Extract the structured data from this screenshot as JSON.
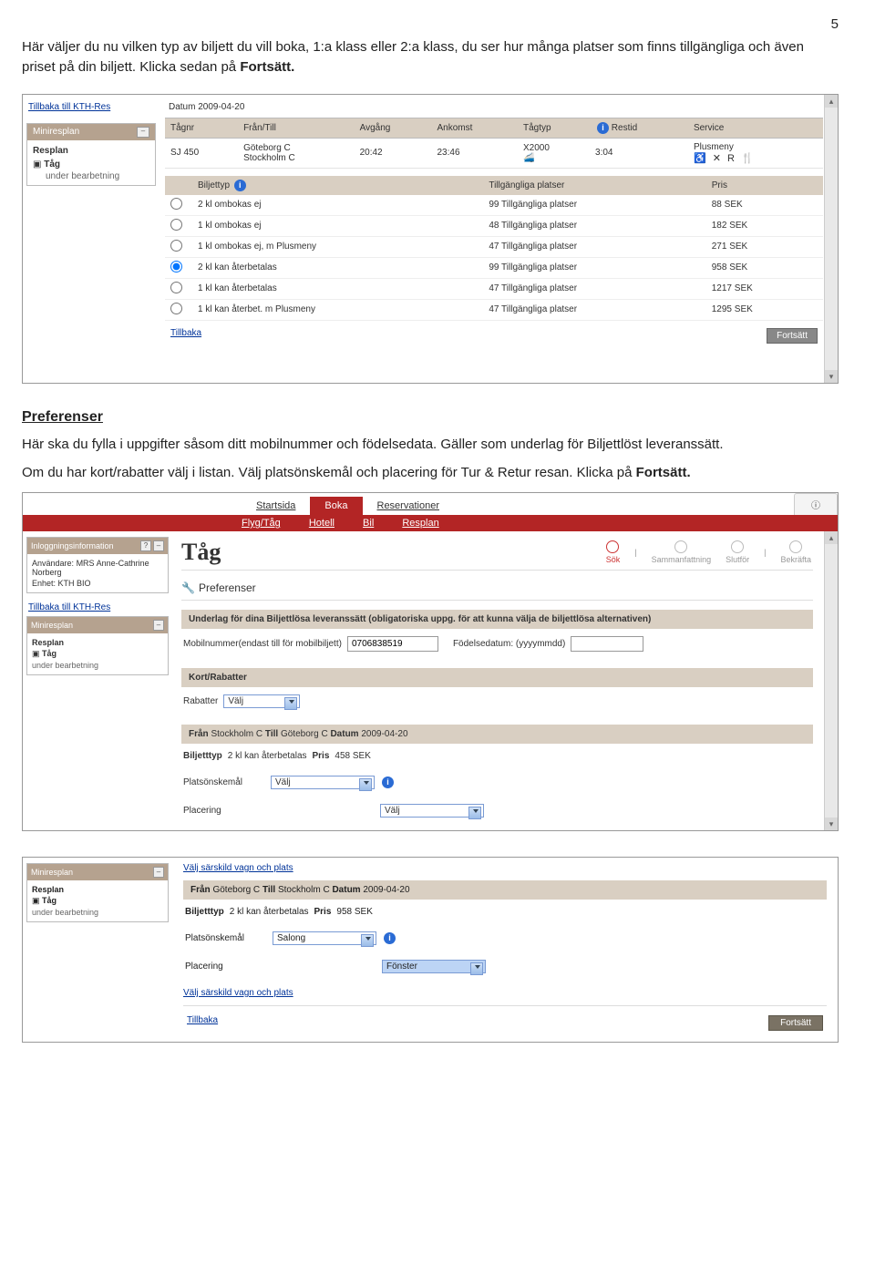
{
  "pageNumber": "5",
  "intro": {
    "part1": "Här väljer du nu vilken typ av biljett du vill boka, 1:a klass eller 2:a klass, du ser hur många platser som finns tillgängliga och även priset på din biljett. Klicka sedan på ",
    "bold": "Fortsätt.",
    "part2": ""
  },
  "shot1": {
    "sidebarLink": "Tillbaka till KTH-Res",
    "miniresplan": "Miniresplan",
    "resplan": "Resplan",
    "tag": "Tåg",
    "underBearb": "under bearbetning",
    "datumLabel": "Datum",
    "datumValue": "2009-04-20",
    "headers": {
      "tagnr": "Tågnr",
      "frantill": "Från/Till",
      "avgang": "Avgång",
      "ankomst": "Ankomst",
      "tagtyp": "Tågtyp",
      "restid": "Restid",
      "service": "Service"
    },
    "train": {
      "nr": "SJ 450",
      "from": "Göteborg C",
      "to": "Stockholm C",
      "avg": "20:42",
      "ank": "23:46",
      "typ": "X2000",
      "restid": "3:04",
      "service": "Plusmeny"
    },
    "ticketHeaders": {
      "biltyp": "Biljettyp",
      "platser": "Tillgängliga platser",
      "pris": "Pris"
    },
    "tickets": [
      {
        "typ": "2 kl ombokas ej",
        "platser": "99 Tillgängliga platser",
        "pris": "88 SEK",
        "checked": false
      },
      {
        "typ": "1 kl ombokas ej",
        "platser": "48 Tillgängliga platser",
        "pris": "182 SEK",
        "checked": false
      },
      {
        "typ": "1 kl ombokas ej, m Plusmeny",
        "platser": "47 Tillgängliga platser",
        "pris": "271 SEK",
        "checked": false
      },
      {
        "typ": "2 kl kan återbetalas",
        "platser": "99 Tillgängliga platser",
        "pris": "958 SEK",
        "checked": true
      },
      {
        "typ": "1 kl kan återbetalas",
        "platser": "47 Tillgängliga platser",
        "pris": "1217 SEK",
        "checked": false
      },
      {
        "typ": "1 kl kan återbet. m Plusmeny",
        "platser": "47 Tillgängliga platser",
        "pris": "1295 SEK",
        "checked": false
      }
    ],
    "tillbaka": "Tillbaka",
    "fortsatt": "Fortsätt",
    "badge": "i"
  },
  "pref": {
    "heading": "Preferenser",
    "p1": "Här ska du fylla i uppgifter såsom ditt mobilnummer och födelsedata. Gäller som underlag för Biljettlöst leveranssätt.",
    "p2a": "Om du har kort/rabatter välj i listan. Välj platsönskemål och placering för Tur & Retur resan. Klicka på ",
    "p2b": "Fortsätt."
  },
  "shot2": {
    "topnav": {
      "start": "Startsida",
      "boka": "Boka",
      "reserv": "Reservationer"
    },
    "subnav": {
      "flyg": "Flyg/Tåg",
      "hotell": "Hotell",
      "bil": "Bil",
      "resplan": "Resplan"
    },
    "info": {
      "hd": "Inloggningsinformation",
      "anvL": "Användare:",
      "anvV": "MRS Anne-Cathrine Norberg",
      "enhL": "Enhet:",
      "enhV": "KTH BIO"
    },
    "sidebarLink": "Tillbaka till KTH-Res",
    "miniresplan": "Miniresplan",
    "resplan": "Resplan",
    "tag": "Tåg",
    "underBearb": "under bearbetning",
    "title": "Tåg",
    "steps": {
      "sok": "Sök",
      "samman": "Sammanfattning",
      "slutfor": "Slutför",
      "bekrafta": "Bekräfta"
    },
    "prefHd": "Preferenser",
    "band1": "Underlag för dina Biljettlösa leveranssätt (obligatoriska uppg. för att kunna välja de biljettlösa alternativen)",
    "mobilL": "Mobilnummer(endast till för mobilbiljett)",
    "mobilV": "0706838519",
    "fodelL": "Födelsedatum: (yyyymmdd)",
    "fodelV": "",
    "band2": "Kort/Rabatter",
    "rabL": "Rabatter",
    "rabV": "Välj",
    "band3a": "Från",
    "band3b": "Stockholm C",
    "band3c": "Till",
    "band3d": "Göteborg C",
    "band3e": "Datum",
    "band3f": "2009-04-20",
    "biljtypL": "Biljetttyp",
    "biljtypV": "2 kl kan återbetalas",
    "prisL": "Pris",
    "prisV": "458 SEK",
    "platsL": "Platsönskemål",
    "platsV": "Välj",
    "placerL": "Placering",
    "placerV": "Välj",
    "badge": "i"
  },
  "shot3": {
    "miniresplan": "Miniresplan",
    "resplan": "Resplan",
    "tag": "Tåg",
    "underBearb": "under bearbetning",
    "valjVagn": "Välj särskild vagn och plats",
    "bandA": "Från",
    "bandB": "Göteborg C",
    "bandC": "Till",
    "bandD": "Stockholm C",
    "bandE": "Datum",
    "bandF": "2009-04-20",
    "biljtypL": "Biljetttyp",
    "biljtypV": "2 kl kan återbetalas",
    "prisL": "Pris",
    "prisV": "958 SEK",
    "platsL": "Platsönskemål",
    "platsV": "Salong",
    "placerL": "Placering",
    "placerV": "Fönster",
    "valjVagn2": "Välj särskild vagn och plats",
    "tillbaka": "Tillbaka",
    "fortsatt": "Fortsätt",
    "badge": "i"
  }
}
